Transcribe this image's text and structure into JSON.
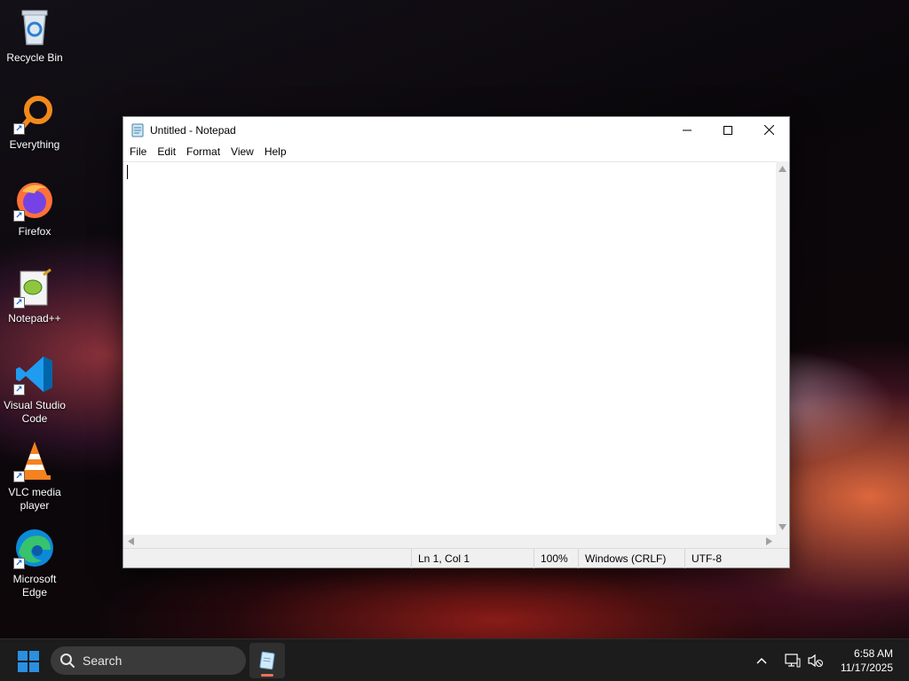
{
  "desktop": {
    "icons": [
      {
        "label": "Recycle Bin"
      },
      {
        "label": "Everything"
      },
      {
        "label": "Firefox"
      },
      {
        "label": "Notepad++"
      },
      {
        "label": "Visual Studio Code"
      },
      {
        "label": "VLC media player"
      },
      {
        "label": "Microsoft Edge"
      }
    ]
  },
  "window": {
    "title": "Untitled - Notepad",
    "menu": [
      "File",
      "Edit",
      "Format",
      "View",
      "Help"
    ],
    "editor_text": "",
    "status": {
      "position": "Ln 1, Col 1",
      "zoom": "100%",
      "line_ending": "Windows (CRLF)",
      "encoding": "UTF-8"
    }
  },
  "taskbar": {
    "search_placeholder": "Search",
    "time": "6:58 AM",
    "date": "11/17/2025"
  },
  "colors": {
    "taskbar_bg": "#1c1c1c",
    "start_blue": "#2b8fe0",
    "active_indicator": "#e8725a"
  }
}
